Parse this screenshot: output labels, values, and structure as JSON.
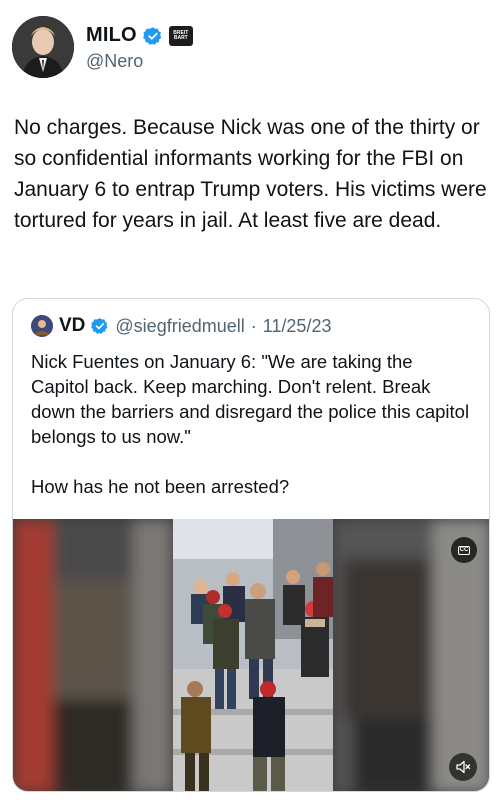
{
  "author": {
    "display_name": "MILO",
    "handle": "@Nero",
    "avatar_icon": "profile-photo",
    "verified_icon": "verified-badge-icon",
    "affiliate_badge_icon": "breitbart-badge-icon",
    "affiliate_badge_text": "BREIT BART"
  },
  "tweet": {
    "text": "No charges. Because Nick was one of the thirty or so confidential informants working for the FBI on January 6 to entrap Trump voters. His victims were tortured for years in jail. At least five are dead."
  },
  "quoted": {
    "display_name": "VD",
    "handle": "@siegfriedmuell",
    "separator": "·",
    "date": "11/25/23",
    "body_1": "Nick Fuentes on January 6: \"We are taking the Capitol back.  Keep marching.  Don't relent. Break down the barriers and disregard the police this capitol belongs to us now.\"",
    "body_2": "How has he not been arrested?",
    "media": {
      "cc_label": "CC",
      "mute_icon": "mute-icon"
    }
  },
  "colors": {
    "verified": "#1d9bf0",
    "text": "#0f1419",
    "muted": "#536471",
    "border": "#cfd9de"
  }
}
